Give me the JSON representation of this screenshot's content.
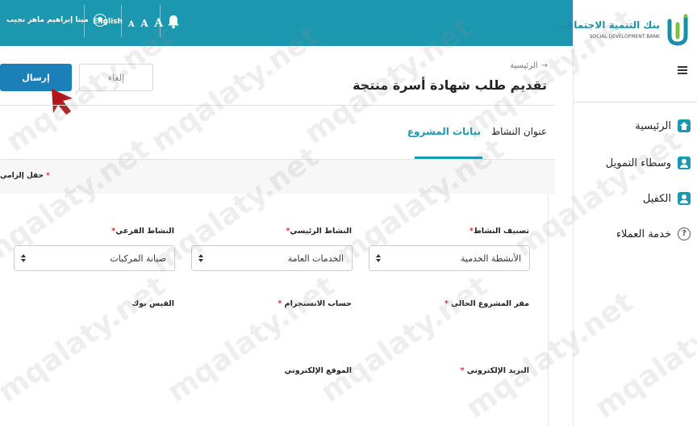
{
  "topbar": {
    "user_name": "مينا إبراهيم ماهر نجيب",
    "language_label": "English",
    "font_size_labels": [
      "A",
      "A",
      "A"
    ],
    "user_icon": "user-icon",
    "bell_icon": "bell-icon",
    "background_color": "#1b97b0"
  },
  "logo": {
    "arabic_name": "بنك التنمية الاجتماعية",
    "english_name": "SOCIAL DEVELOPMENT BANK"
  },
  "sidebar": {
    "items": [
      {
        "label": "الرئيسية",
        "icon": "home-icon"
      },
      {
        "label": "وسطاء التمويل",
        "icon": "person-icon"
      },
      {
        "label": "الكفيل",
        "icon": "person-icon"
      },
      {
        "label": "خدمة العملاء",
        "icon": "help-icon"
      }
    ],
    "help_glyph": "?"
  },
  "header": {
    "breadcrumb": "الرئيسية",
    "title": "تقديم طلب شهادة أسرة منتجة",
    "submit_label": "إرسال",
    "cancel_label": "إلغاء"
  },
  "tabs": [
    {
      "label": "عنوان النشاط",
      "active": false
    },
    {
      "label": "بيانات المشروع",
      "active": true
    }
  ],
  "required_note": "حقل إلزامي",
  "required_mark": "*",
  "form": {
    "activity_category": {
      "label": "تصنيف النشاط",
      "value": "الأنشطة الخدمية"
    },
    "main_activity": {
      "label": "النشاط الرئيسي",
      "value": "الخدمات العامة"
    },
    "sub_activity": {
      "label": "النشاط الفرعي",
      "value": "صيانة المركبات"
    },
    "current_location": {
      "label": "مقر المشروع الحالى"
    },
    "instagram": {
      "label": "حساب الانستجرام"
    },
    "facebook": {
      "label": "الفيس بوك"
    },
    "email": {
      "label": "البريد الإلكتروني"
    },
    "website": {
      "label": "الموقع الإلكتروني"
    }
  },
  "watermark_text": "mqalaty.net",
  "colors": {
    "accent": "#1b97b0",
    "submit": "#1b7fb8",
    "required": "#dd3333"
  }
}
